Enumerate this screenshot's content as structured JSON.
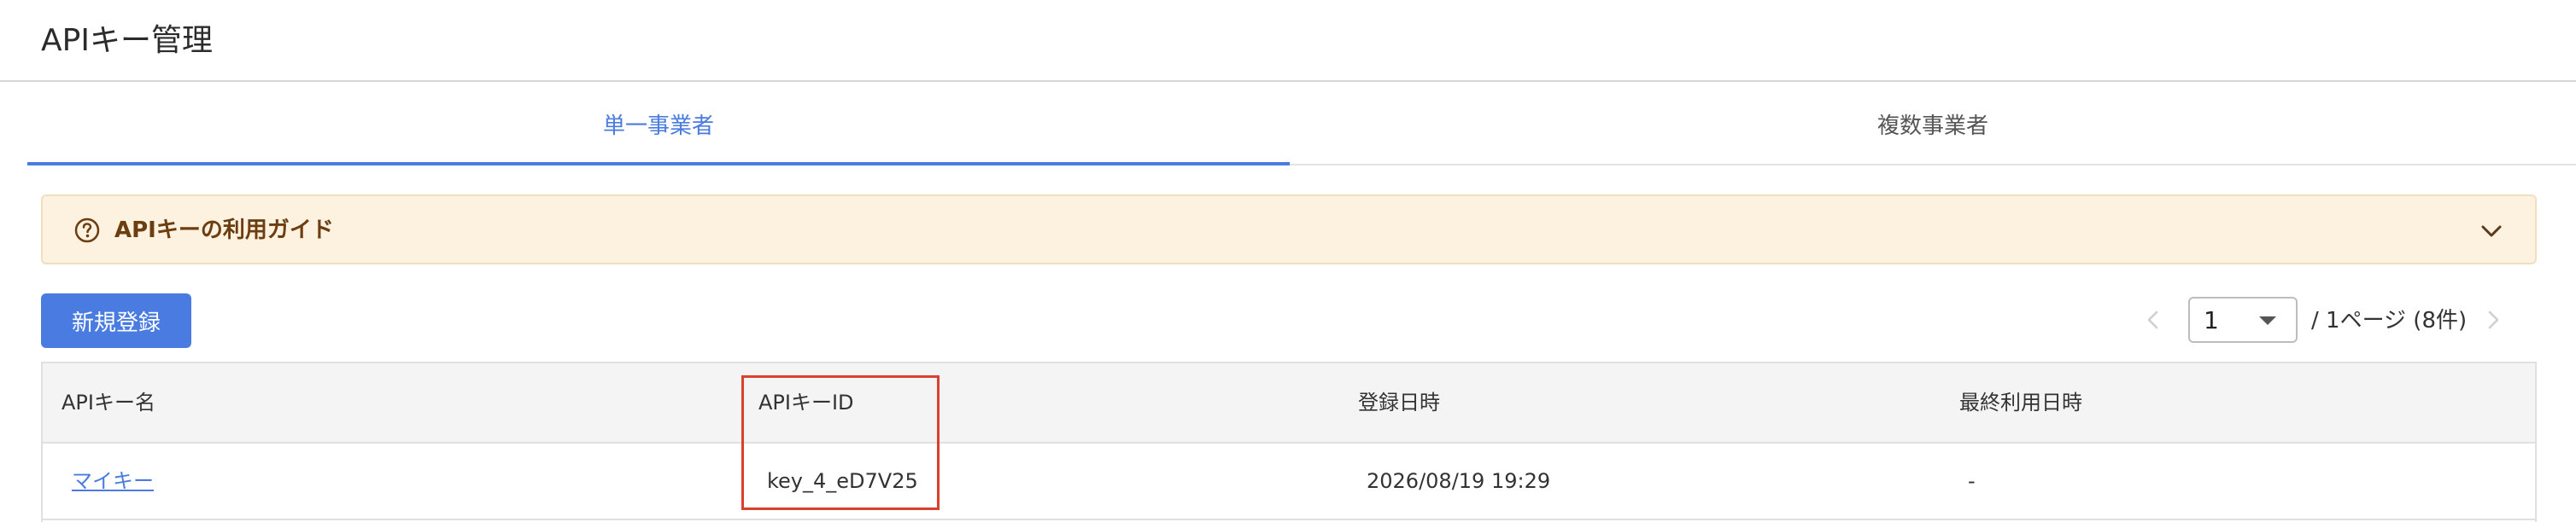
{
  "header": {
    "title": "APIキー管理"
  },
  "tabs": [
    {
      "label": "単一事業者",
      "active": true
    },
    {
      "label": "複数事業者",
      "active": false
    }
  ],
  "guide": {
    "label": "APIキーの利用ガイド",
    "icon": "help-circle-icon",
    "chevron": "chevron-down-icon"
  },
  "toolbar": {
    "new_button_label": "新規登録"
  },
  "pagination": {
    "current_page": "1",
    "info": "/ 1ページ (8件)"
  },
  "table": {
    "columns": [
      "APIキー名",
      "APIキーID",
      "登録日時",
      "最終利用日時"
    ],
    "rows": [
      {
        "name": "マイキー",
        "key_id": "key_4_eD7V25",
        "registered_at": "2026/08/19 19:29",
        "last_used": "-"
      }
    ]
  },
  "colors": {
    "accent": "#4a7be0",
    "guide_bg": "#fdf2df",
    "guide_text": "#6d3d12",
    "highlight": "#d9412e"
  }
}
